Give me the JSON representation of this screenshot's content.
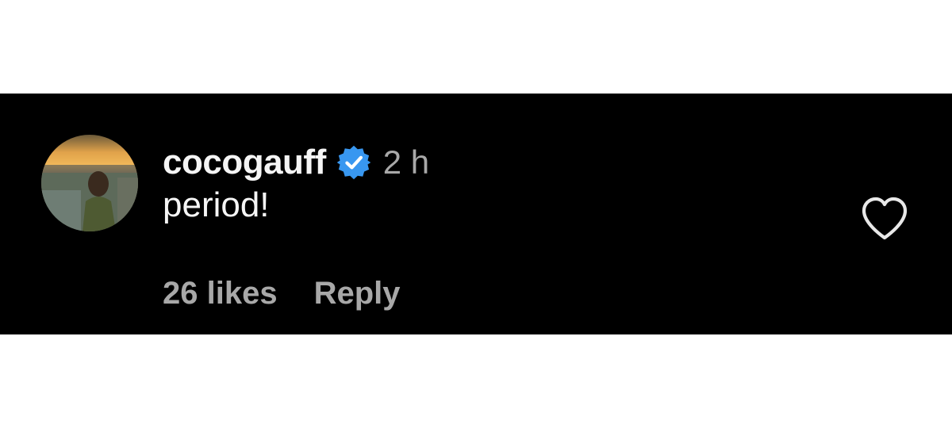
{
  "comment": {
    "username": "cocogauff",
    "verified": true,
    "timestamp": "2 h",
    "text": "period!",
    "likes": "26 likes",
    "reply_label": "Reply"
  },
  "colors": {
    "background": "#000000",
    "primary_text": "#f5f5f5",
    "secondary_text": "#a8a8a8",
    "verified_badge": "#3897f0"
  },
  "icons": {
    "verified": "verified-badge-icon",
    "like": "heart-outline-icon"
  }
}
